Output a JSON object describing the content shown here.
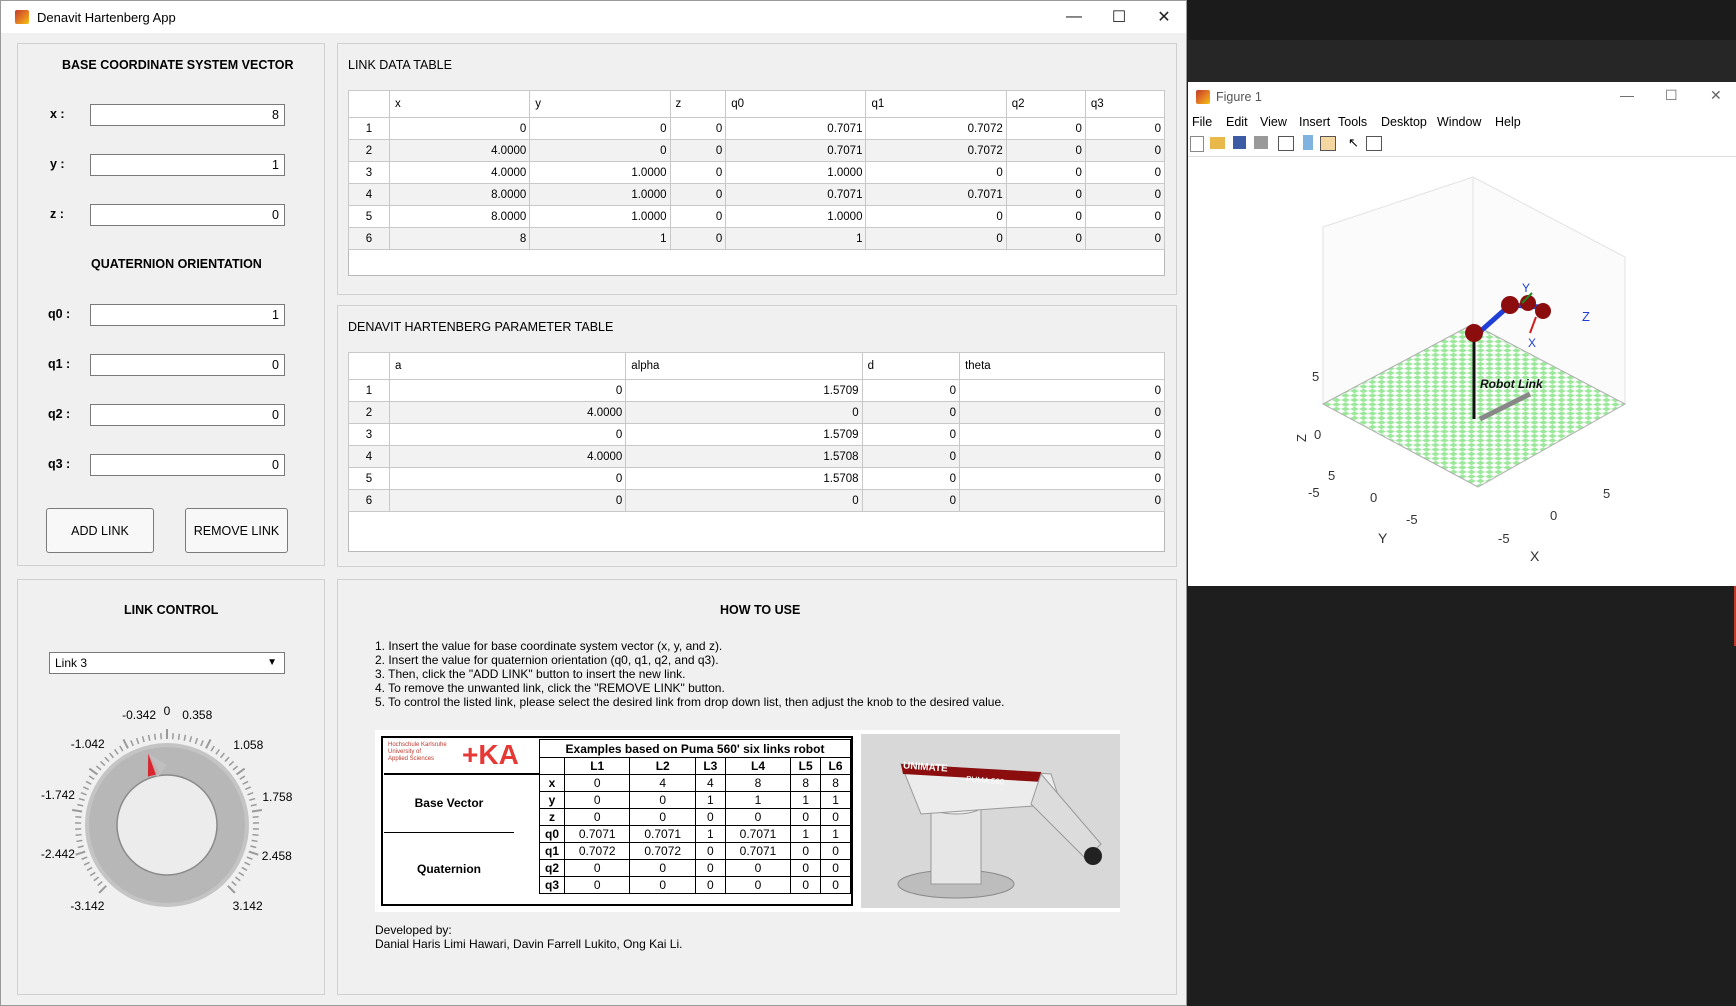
{
  "app": {
    "title": "Denavit Hartenberg App",
    "controls": {
      "minimize": "—",
      "maximize": "☐",
      "close": "✕"
    }
  },
  "base_panel": {
    "title": "BASE COORDINATE SYSTEM VECTOR",
    "x_label": "x :",
    "x_value": "8",
    "y_label": "y :",
    "y_value": "1",
    "z_label": "z :",
    "z_value": "0",
    "quat_title": "QUATERNION ORIENTATION",
    "q0_label": "q0 :",
    "q0_value": "1",
    "q1_label": "q1 :",
    "q1_value": "0",
    "q2_label": "q2 :",
    "q2_value": "0",
    "q3_label": "q3 :",
    "q3_value": "0",
    "add_button": "ADD LINK",
    "remove_button": "REMOVE LINK"
  },
  "link_table": {
    "title": "LINK DATA TABLE",
    "columns": [
      "x",
      "y",
      "z",
      "q0",
      "q1",
      "q2",
      "q3"
    ],
    "rows": [
      [
        "1",
        "0",
        "0",
        "0",
        "0.7071",
        "0.7072",
        "0",
        "0"
      ],
      [
        "2",
        "4.0000",
        "0",
        "0",
        "0.7071",
        "0.7072",
        "0",
        "0"
      ],
      [
        "3",
        "4.0000",
        "1.0000",
        "0",
        "1.0000",
        "0",
        "0",
        "0"
      ],
      [
        "4",
        "8.0000",
        "1.0000",
        "0",
        "0.7071",
        "0.7071",
        "0",
        "0"
      ],
      [
        "5",
        "8.0000",
        "1.0000",
        "0",
        "1.0000",
        "0",
        "0",
        "0"
      ],
      [
        "6",
        "8",
        "1",
        "0",
        "1",
        "0",
        "0",
        "0"
      ]
    ]
  },
  "dh_table": {
    "title": "DENAVIT HARTENBERG PARAMETER TABLE",
    "columns": [
      "a",
      "alpha",
      "d",
      "theta"
    ],
    "rows": [
      [
        "1",
        "0",
        "1.5709",
        "0",
        "0"
      ],
      [
        "2",
        "4.0000",
        "0",
        "0",
        "0"
      ],
      [
        "3",
        "0",
        "1.5709",
        "0",
        "0"
      ],
      [
        "4",
        "4.0000",
        "1.5708",
        "0",
        "0"
      ],
      [
        "5",
        "0",
        "1.5708",
        "0",
        "0"
      ],
      [
        "6",
        "0",
        "0",
        "0",
        "0"
      ]
    ]
  },
  "link_control": {
    "title": "LINK CONTROL",
    "selected": "Link 3",
    "knob_labels": [
      "-3.142",
      "-2.442",
      "-1.742",
      "-1.042",
      "-0.342",
      "0",
      "0.358",
      "1.058",
      "1.758",
      "2.458",
      "3.142"
    ],
    "knob_value": -0.342
  },
  "how_to": {
    "title": "HOW TO USE",
    "steps": [
      "1. Insert the value for base coordinate system vector (x, y, and z).",
      "2. Insert the value for quaternion orientation (q0, q1, q2, and q3).",
      "3. Then, click the \"ADD LINK\" button to insert the new link.",
      "4. To remove the unwanted link, click the \"REMOVE LINK\" button.",
      "5. To control the listed link, please select the desired link from drop down list, then adjust the knob to the desired value."
    ],
    "logo_text": "+KA",
    "logo_small": [
      "Hochschule Karlsruhe",
      "University of",
      "Applied Sciences"
    ],
    "example_title": "Examples based on Puma 560' six links robot",
    "example_cols": [
      "L1",
      "L2",
      "L3",
      "L4",
      "L5",
      "L6"
    ],
    "base_vector_label": "Base Vector",
    "quaternion_label": "Quaternion",
    "example_rows": [
      [
        "x",
        "0",
        "4",
        "4",
        "8",
        "8",
        "8"
      ],
      [
        "y",
        "0",
        "0",
        "1",
        "1",
        "1",
        "1"
      ],
      [
        "z",
        "0",
        "0",
        "0",
        "0",
        "0",
        "0"
      ],
      [
        "q0",
        "0.7071",
        "0.7071",
        "1",
        "0.7071",
        "1",
        "1"
      ],
      [
        "q1",
        "0.7072",
        "0.7072",
        "0",
        "0.7071",
        "0",
        "0"
      ],
      [
        "q2",
        "0",
        "0",
        "0",
        "0",
        "0",
        "0"
      ],
      [
        "q3",
        "0",
        "0",
        "0",
        "0",
        "0",
        "0"
      ]
    ],
    "robot_brand": "UNIMATE",
    "robot_model": "PUMA 560",
    "developed_by": "Developed by:",
    "authors": "Danial Haris Limi Hawari, Davin Farrell Lukito, Ong Kai Li."
  },
  "figure": {
    "title": "Figure 1",
    "menu": [
      "File",
      "Edit",
      "View",
      "Insert",
      "Tools",
      "Desktop",
      "Window",
      "Help"
    ],
    "z_ticks": [
      "5",
      "0",
      "-5"
    ],
    "y_ticks": [
      "5",
      "0",
      "-5"
    ],
    "x_ticks": [
      "5",
      "0",
      "-5"
    ],
    "axis_x": "X",
    "axis_y": "Y",
    "axis_z": "Z",
    "frame_x": "X",
    "frame_y": "Y",
    "frame_z": "Z",
    "annotation": "Robot Link",
    "colors": {
      "floor_a": "#9be89b",
      "floor_b": "#ffffff",
      "link": "#1f3fd6",
      "joint": "#8b0d0d"
    }
  }
}
